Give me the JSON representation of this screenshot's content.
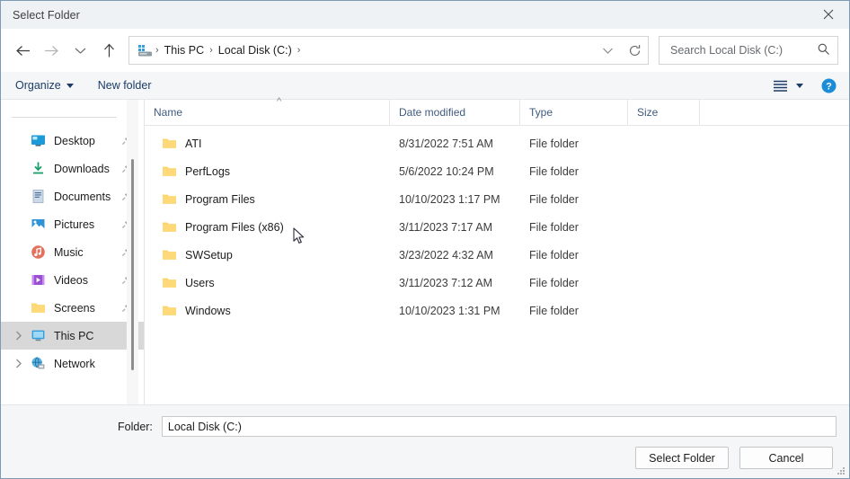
{
  "window": {
    "title": "Select Folder",
    "close_label": "Close"
  },
  "nav": {
    "back": "Back",
    "forward": "Forward",
    "recent": "Recent locations",
    "up": "Up",
    "dropdown": "Previous locations",
    "refresh": "Refresh"
  },
  "address": {
    "drive_icon": "this-pc-icon",
    "crumbs": [
      "This PC",
      "Local Disk (C:)"
    ],
    "separator": "›",
    "trailing_separator": "›"
  },
  "search": {
    "placeholder": "Search Local Disk (C:)",
    "value": "",
    "icon": "search-icon"
  },
  "commandbar": {
    "organize": "Organize",
    "new_folder": "New folder",
    "view_icon": "view-list-icon",
    "view_caret": "chevron-down-icon",
    "help": "?"
  },
  "sidebar": {
    "items": [
      {
        "label": "Desktop",
        "icon": "desktop-icon",
        "pinned": true,
        "chevron": false,
        "selected": false
      },
      {
        "label": "Downloads",
        "icon": "downloads-icon",
        "pinned": true,
        "chevron": false,
        "selected": false
      },
      {
        "label": "Documents",
        "icon": "documents-icon",
        "pinned": true,
        "chevron": false,
        "selected": false
      },
      {
        "label": "Pictures",
        "icon": "pictures-icon",
        "pinned": true,
        "chevron": false,
        "selected": false
      },
      {
        "label": "Music",
        "icon": "music-icon",
        "pinned": true,
        "chevron": false,
        "selected": false
      },
      {
        "label": "Videos",
        "icon": "videos-icon",
        "pinned": true,
        "chevron": false,
        "selected": false
      },
      {
        "label": "Screens",
        "icon": "folder-icon",
        "pinned": true,
        "chevron": false,
        "selected": false
      },
      {
        "label": "This PC",
        "icon": "this-pc-icon",
        "pinned": false,
        "chevron": true,
        "selected": true
      },
      {
        "label": "Network",
        "icon": "network-icon",
        "pinned": false,
        "chevron": true,
        "selected": false
      }
    ]
  },
  "filelist": {
    "columns": [
      "Name",
      "Date modified",
      "Type",
      "Size"
    ],
    "sort_column": "Name",
    "sort_direction": "ascending",
    "rows": [
      {
        "name": "ATI",
        "date": "8/31/2022 7:51 AM",
        "type": "File folder",
        "size": ""
      },
      {
        "name": "PerfLogs",
        "date": "5/6/2022 10:24 PM",
        "type": "File folder",
        "size": ""
      },
      {
        "name": "Program Files",
        "date": "10/10/2023 1:17 PM",
        "type": "File folder",
        "size": ""
      },
      {
        "name": "Program Files (x86)",
        "date": "3/11/2023 7:17 AM",
        "type": "File folder",
        "size": ""
      },
      {
        "name": "SWSetup",
        "date": "3/23/2022 4:32 AM",
        "type": "File folder",
        "size": ""
      },
      {
        "name": "Users",
        "date": "3/11/2023 7:12 AM",
        "type": "File folder",
        "size": ""
      },
      {
        "name": "Windows",
        "date": "10/10/2023 1:31 PM",
        "type": "File folder",
        "size": ""
      }
    ]
  },
  "footer": {
    "folder_label": "Folder:",
    "folder_value": "Local Disk (C:)",
    "folder_placeholder": "",
    "select_button": "Select Folder",
    "cancel_button": "Cancel"
  },
  "colors": {
    "titlebar": "#eef2f5",
    "window_border": "#7f9ab5",
    "command_bar": "#f4f6f8",
    "folder_yellow": "#fcd462",
    "accent_blue": "#1b8cd8",
    "selection_gray": "#d8d8d8"
  }
}
